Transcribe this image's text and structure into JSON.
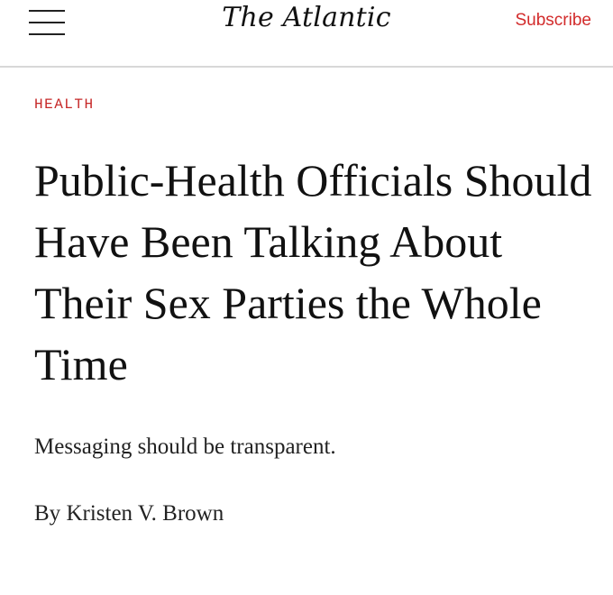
{
  "header": {
    "menu_icon": "hamburger-menu-icon",
    "logo_text": "The Atlantic",
    "subscribe_label": "Subscribe",
    "accent_color": "#d22b2b"
  },
  "article": {
    "section": "HEALTH",
    "headline": "Public-Health Officials Should Have Been Talking About Their Sex Parties the Whole Time",
    "dek": "Messaging should be transparent.",
    "byline_prefix": "By",
    "author": "Kristen V. Brown"
  }
}
